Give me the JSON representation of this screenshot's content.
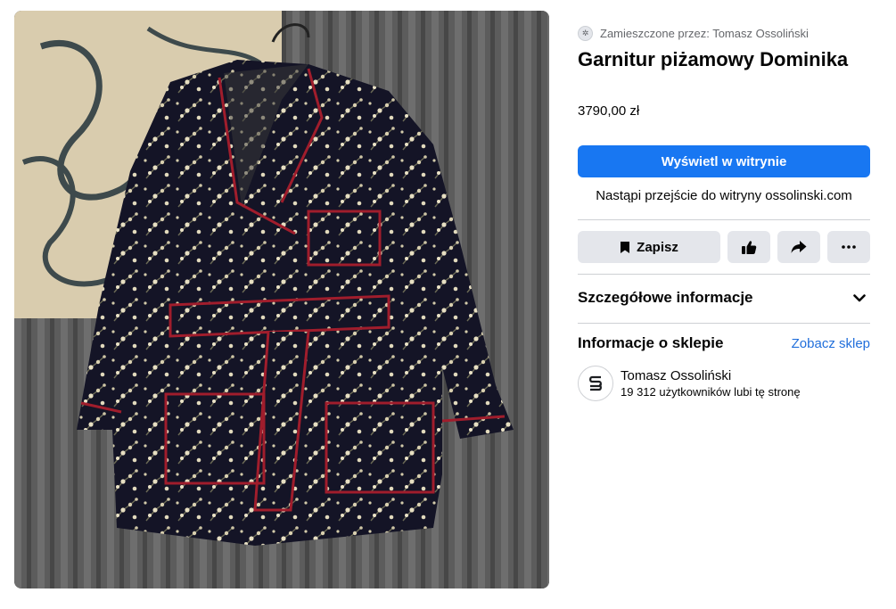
{
  "product": {
    "posted_by": "Zamieszczone przez: Tomasz Ossoliński",
    "title": "Garnitur piżamowy Dominika",
    "price": "3790,00 zł",
    "image_alt": "Garnitur piżamowy Dominika"
  },
  "actions": {
    "view_site_label": "Wyświetl w witrynie",
    "redirect_note": "Nastąpi przejście do witryny ossolinski.com",
    "save_label": "Zapisz",
    "like_icon": "thumbs-up-icon",
    "share_icon": "share-icon",
    "more_icon": "more-horizontal-icon"
  },
  "details": {
    "label": "Szczegółowe informacje",
    "icon": "chevron-down-icon"
  },
  "shop_info": {
    "label": "Informacje o sklepie",
    "link": "Zobacz sklep",
    "name": "Tomasz Ossoliński",
    "likes": "19 312 użytkowników lubi tę stronę"
  },
  "colors": {
    "accent": "#1877f2",
    "link": "#216fdb",
    "button_gray": "#e4e6eb",
    "divider": "#ced0d4",
    "secondary_text": "#65676b"
  }
}
